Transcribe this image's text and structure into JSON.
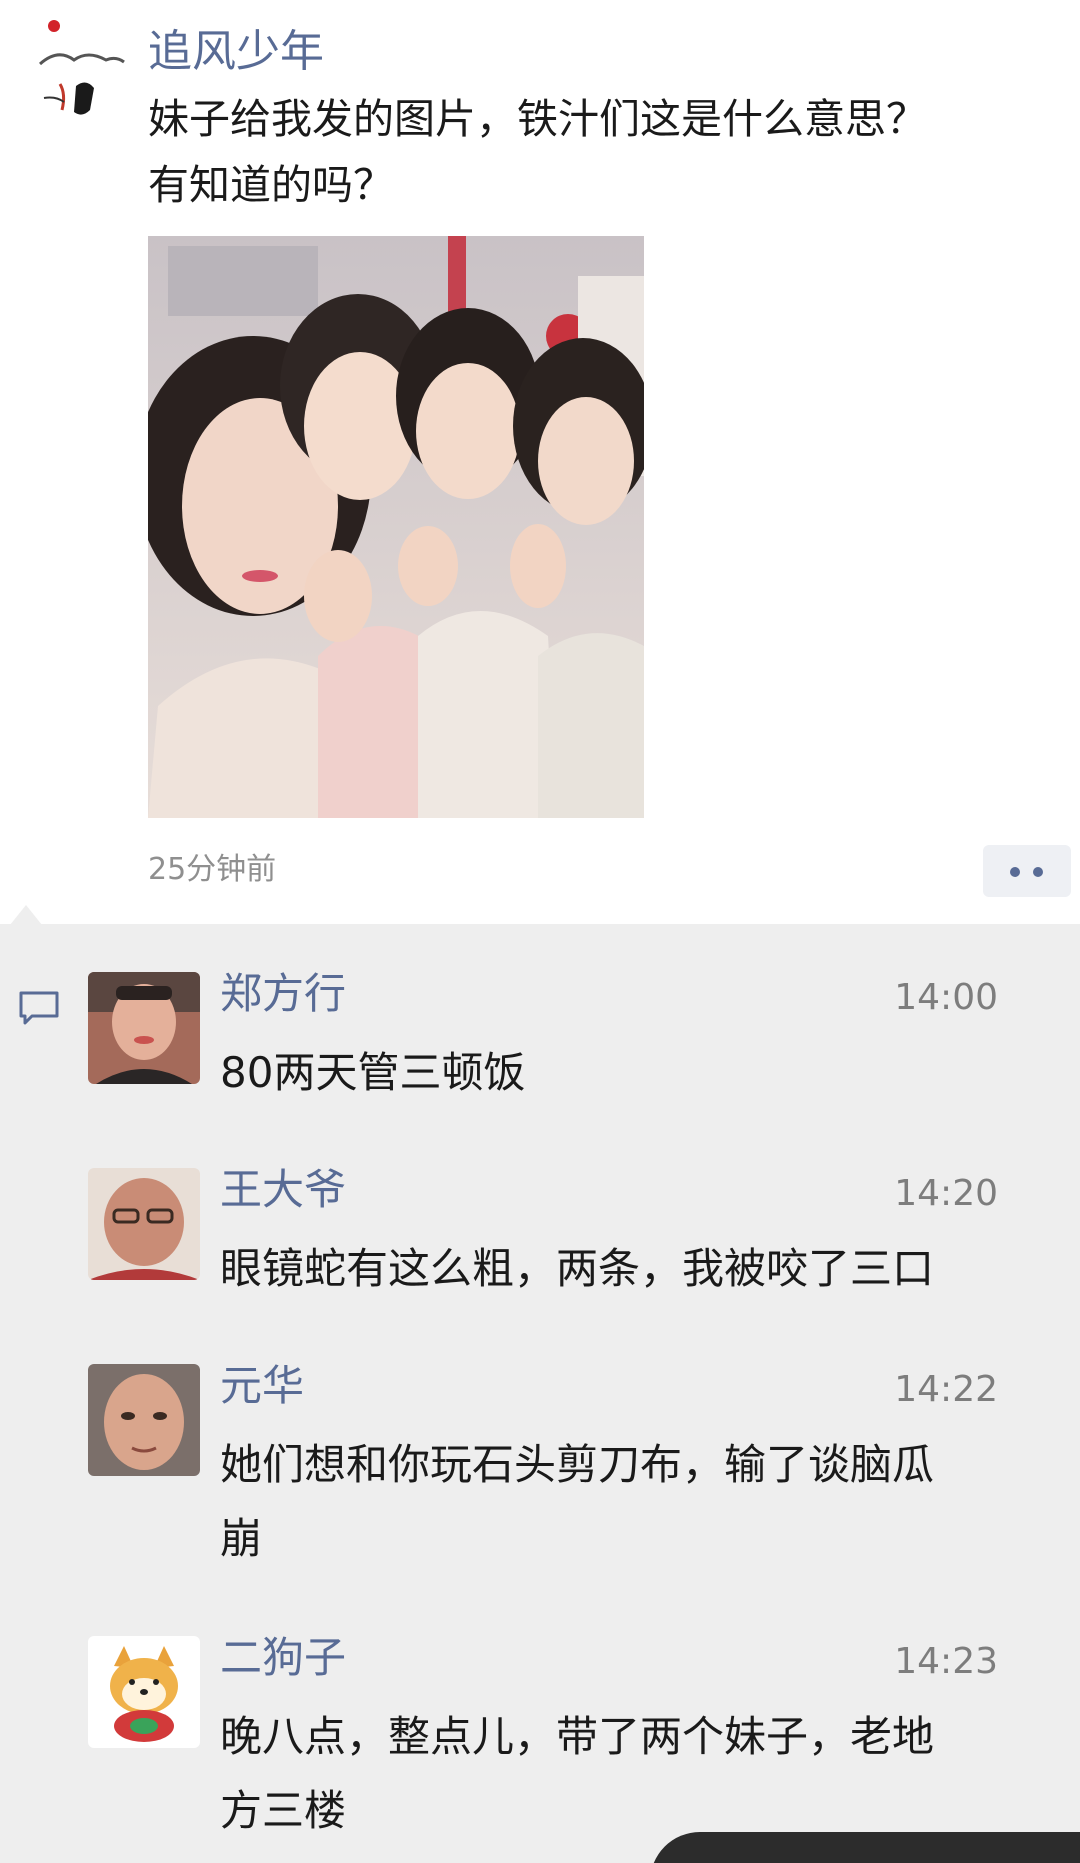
{
  "post": {
    "author": "追风少年",
    "text_lines": [
      "妹子给我发的图片，铁汁们这是什么意思？",
      "有知道的吗？"
    ],
    "time": "25分钟前",
    "avatar_icon": "ink-painting-avatar",
    "photo_icon": "four-girls-selfie-photo"
  },
  "comments": [
    {
      "name": "郑方行",
      "time": "14:00",
      "lines": [
        "80两天管三顿饭"
      ]
    },
    {
      "name": "王大爷",
      "time": "14:20",
      "lines": [
        "眼镜蛇有这么粗，两条，我被咬了三口"
      ]
    },
    {
      "name": "元华",
      "time": "14:22",
      "lines": [
        "她们想和你玩石头剪刀布，输了谈脑瓜",
        "崩"
      ]
    },
    {
      "name": "二狗子",
      "time": "14:23",
      "lines": [
        "晚八点，整点儿，带了两个妹子，老地",
        "方三楼"
      ]
    }
  ],
  "colors": {
    "name_link": "#586b95",
    "comments_bg": "#eeeeee",
    "time_gray": "#8f8f8f"
  }
}
